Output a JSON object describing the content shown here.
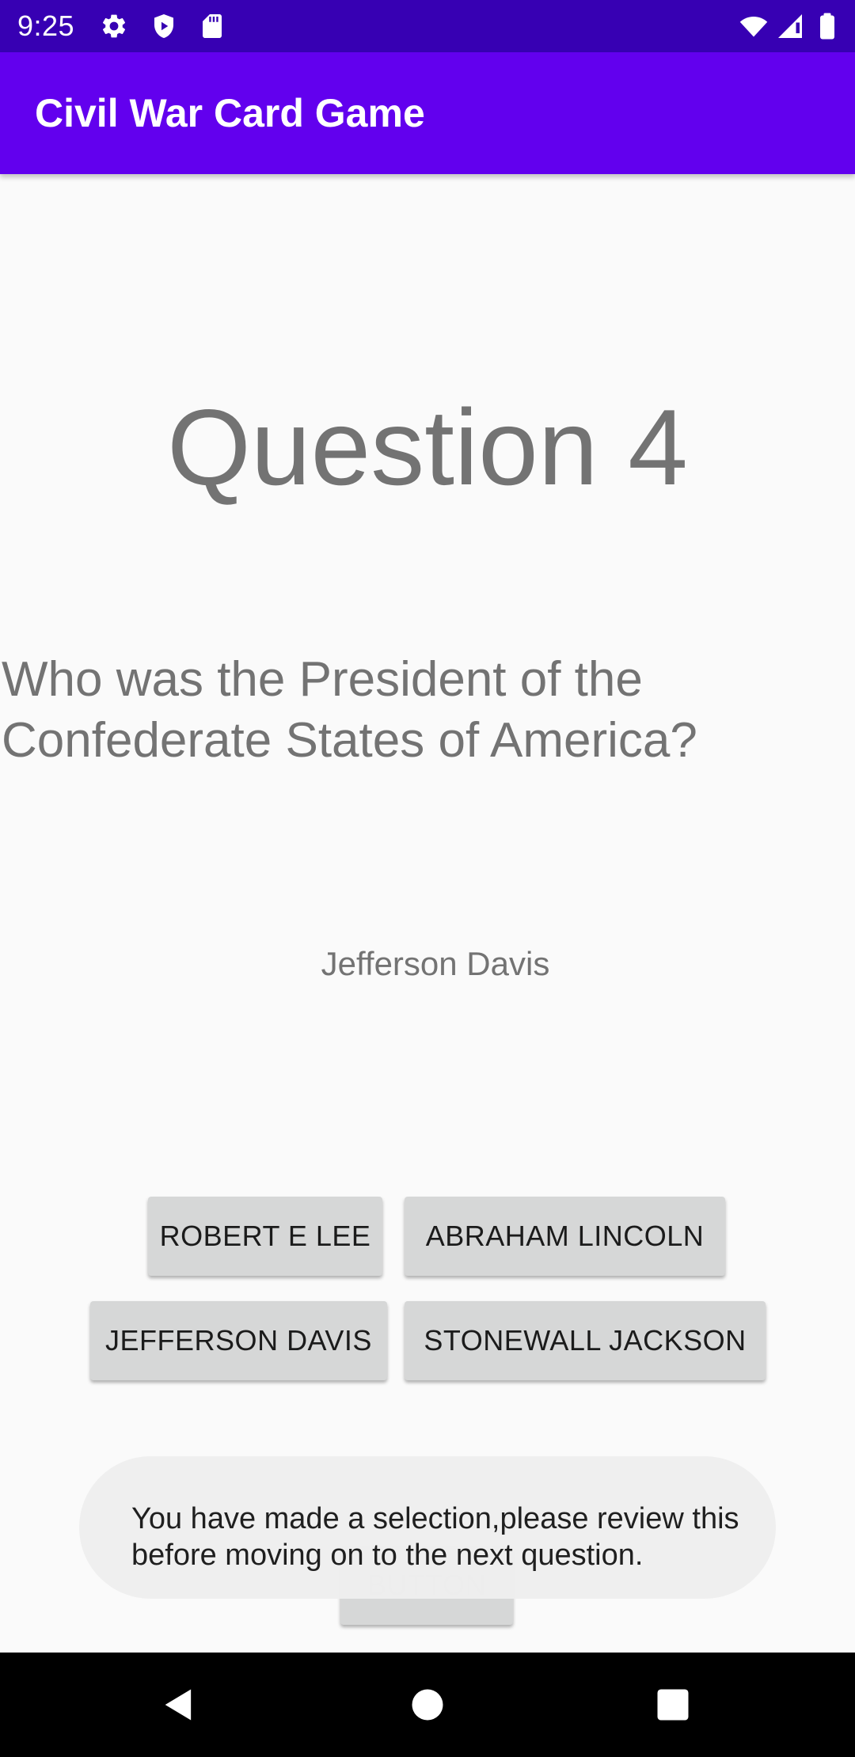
{
  "status_bar": {
    "time": "9:25",
    "left_icons": [
      "gear-icon",
      "shield-icon",
      "sd-card-icon"
    ],
    "right_icons": [
      "wifi-icon",
      "signal-icon",
      "battery-icon"
    ],
    "color": "#3700b3"
  },
  "app_bar": {
    "title": "Civil War Card Game",
    "color": "#6200ee"
  },
  "quiz": {
    "question_number": "Question 4",
    "question_text": "Who was the President of the Confederate States of America?",
    "selected_answer": "Jefferson Davis",
    "options": [
      "ROBERT E LEE",
      "ABRAHAM LINCOLN",
      "JEFFERSON DAVIS",
      "STONEWALL JACKSON"
    ],
    "next_button": "BUTTON"
  },
  "toast": {
    "message": "You have made a selection,please review this before moving on to the next question."
  },
  "nav_bar": {
    "items": [
      "back-icon",
      "home-icon",
      "recents-icon"
    ]
  }
}
